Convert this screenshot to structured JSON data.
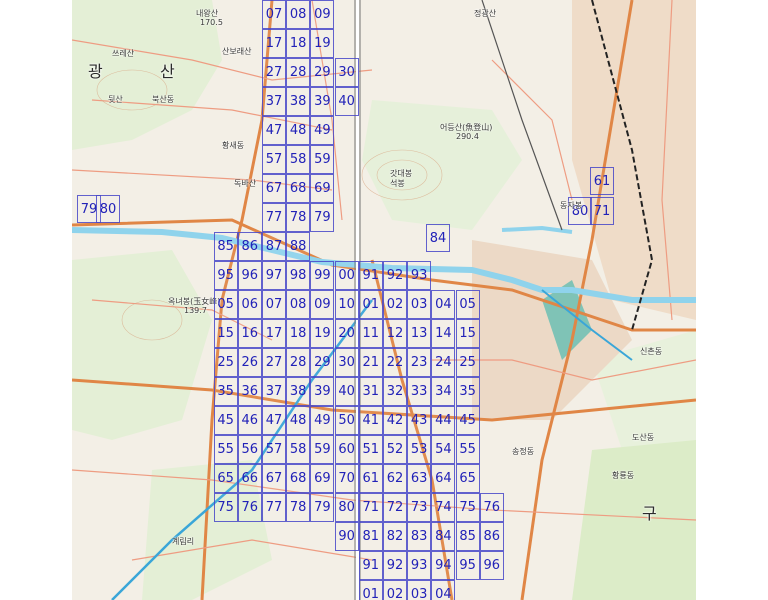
{
  "map": {
    "grid_cells": [
      {
        "label": "07",
        "col": 1,
        "row": 0
      },
      {
        "label": "08",
        "col": 2,
        "row": 0
      },
      {
        "label": "09",
        "col": 3,
        "row": 0
      },
      {
        "label": "17",
        "col": 1,
        "row": 1
      },
      {
        "label": "18",
        "col": 2,
        "row": 1
      },
      {
        "label": "19",
        "col": 3,
        "row": 1
      },
      {
        "label": "27",
        "col": 1,
        "row": 2
      },
      {
        "label": "28",
        "col": 2,
        "row": 2
      },
      {
        "label": "29",
        "col": 3,
        "row": 2
      },
      {
        "label": "30",
        "col": 4,
        "row": 2
      },
      {
        "label": "37",
        "col": 1,
        "row": 3
      },
      {
        "label": "38",
        "col": 2,
        "row": 3
      },
      {
        "label": "39",
        "col": 3,
        "row": 3
      },
      {
        "label": "40",
        "col": 4,
        "row": 3
      },
      {
        "label": "47",
        "col": 1,
        "row": 4
      },
      {
        "label": "48",
        "col": 2,
        "row": 4
      },
      {
        "label": "49",
        "col": 3,
        "row": 4
      },
      {
        "label": "57",
        "col": 1,
        "row": 5
      },
      {
        "label": "58",
        "col": 2,
        "row": 5
      },
      {
        "label": "59",
        "col": 3,
        "row": 5
      },
      {
        "label": "67",
        "col": 1,
        "row": 6
      },
      {
        "label": "68",
        "col": 2,
        "row": 6
      },
      {
        "label": "69",
        "col": 3,
        "row": 6
      },
      {
        "label": "77",
        "col": 1,
        "row": 7
      },
      {
        "label": "78",
        "col": 2,
        "row": 7
      },
      {
        "label": "79",
        "col": 3,
        "row": 7
      },
      {
        "label": "85",
        "col": -1,
        "row": 8
      },
      {
        "label": "86",
        "col": 0,
        "row": 8
      },
      {
        "label": "87",
        "col": 1,
        "row": 8
      },
      {
        "label": "88",
        "col": 2,
        "row": 8
      },
      {
        "label": "95",
        "col": -1,
        "row": 9
      },
      {
        "label": "96",
        "col": 0,
        "row": 9
      },
      {
        "label": "97",
        "col": 1,
        "row": 9
      },
      {
        "label": "98",
        "col": 2,
        "row": 9
      },
      {
        "label": "99",
        "col": 3,
        "row": 9
      },
      {
        "label": "00",
        "col": 4,
        "row": 9
      },
      {
        "label": "91",
        "col": 5,
        "row": 9
      },
      {
        "label": "92",
        "col": 6,
        "row": 9
      },
      {
        "label": "93",
        "col": 7,
        "row": 9
      },
      {
        "label": "05",
        "col": -1,
        "row": 10
      },
      {
        "label": "06",
        "col": 0,
        "row": 10
      },
      {
        "label": "07",
        "col": 1,
        "row": 10
      },
      {
        "label": "08",
        "col": 2,
        "row": 10
      },
      {
        "label": "09",
        "col": 3,
        "row": 10
      },
      {
        "label": "10",
        "col": 4,
        "row": 10
      },
      {
        "label": "01",
        "col": 5,
        "row": 10
      },
      {
        "label": "02",
        "col": 6,
        "row": 10
      },
      {
        "label": "03",
        "col": 7,
        "row": 10
      },
      {
        "label": "04",
        "col": 8,
        "row": 10
      },
      {
        "label": "05",
        "col": 9,
        "row": 10
      },
      {
        "label": "15",
        "col": -1,
        "row": 11
      },
      {
        "label": "16",
        "col": 0,
        "row": 11
      },
      {
        "label": "17",
        "col": 1,
        "row": 11
      },
      {
        "label": "18",
        "col": 2,
        "row": 11
      },
      {
        "label": "19",
        "col": 3,
        "row": 11
      },
      {
        "label": "20",
        "col": 4,
        "row": 11
      },
      {
        "label": "11",
        "col": 5,
        "row": 11
      },
      {
        "label": "12",
        "col": 6,
        "row": 11
      },
      {
        "label": "13",
        "col": 7,
        "row": 11
      },
      {
        "label": "14",
        "col": 8,
        "row": 11
      },
      {
        "label": "15",
        "col": 9,
        "row": 11
      },
      {
        "label": "25",
        "col": -1,
        "row": 12
      },
      {
        "label": "26",
        "col": 0,
        "row": 12
      },
      {
        "label": "27",
        "col": 1,
        "row": 12
      },
      {
        "label": "28",
        "col": 2,
        "row": 12
      },
      {
        "label": "29",
        "col": 3,
        "row": 12
      },
      {
        "label": "30",
        "col": 4,
        "row": 12
      },
      {
        "label": "21",
        "col": 5,
        "row": 12
      },
      {
        "label": "22",
        "col": 6,
        "row": 12
      },
      {
        "label": "23",
        "col": 7,
        "row": 12
      },
      {
        "label": "24",
        "col": 8,
        "row": 12
      },
      {
        "label": "25",
        "col": 9,
        "row": 12
      },
      {
        "label": "35",
        "col": -1,
        "row": 13
      },
      {
        "label": "36",
        "col": 0,
        "row": 13
      },
      {
        "label": "37",
        "col": 1,
        "row": 13
      },
      {
        "label": "38",
        "col": 2,
        "row": 13
      },
      {
        "label": "39",
        "col": 3,
        "row": 13
      },
      {
        "label": "40",
        "col": 4,
        "row": 13
      },
      {
        "label": "31",
        "col": 5,
        "row": 13
      },
      {
        "label": "32",
        "col": 6,
        "row": 13
      },
      {
        "label": "33",
        "col": 7,
        "row": 13
      },
      {
        "label": "34",
        "col": 8,
        "row": 13
      },
      {
        "label": "35",
        "col": 9,
        "row": 13
      },
      {
        "label": "45",
        "col": -1,
        "row": 14
      },
      {
        "label": "46",
        "col": 0,
        "row": 14
      },
      {
        "label": "47",
        "col": 1,
        "row": 14
      },
      {
        "label": "48",
        "col": 2,
        "row": 14
      },
      {
        "label": "49",
        "col": 3,
        "row": 14
      },
      {
        "label": "50",
        "col": 4,
        "row": 14
      },
      {
        "label": "41",
        "col": 5,
        "row": 14
      },
      {
        "label": "42",
        "col": 6,
        "row": 14
      },
      {
        "label": "43",
        "col": 7,
        "row": 14
      },
      {
        "label": "44",
        "col": 8,
        "row": 14
      },
      {
        "label": "45",
        "col": 9,
        "row": 14
      },
      {
        "label": "55",
        "col": -1,
        "row": 15
      },
      {
        "label": "56",
        "col": 0,
        "row": 15
      },
      {
        "label": "57",
        "col": 1,
        "row": 15
      },
      {
        "label": "58",
        "col": 2,
        "row": 15
      },
      {
        "label": "59",
        "col": 3,
        "row": 15
      },
      {
        "label": "60",
        "col": 4,
        "row": 15
      },
      {
        "label": "51",
        "col": 5,
        "row": 15
      },
      {
        "label": "52",
        "col": 6,
        "row": 15
      },
      {
        "label": "53",
        "col": 7,
        "row": 15
      },
      {
        "label": "54",
        "col": 8,
        "row": 15
      },
      {
        "label": "55",
        "col": 9,
        "row": 15
      },
      {
        "label": "65",
        "col": -1,
        "row": 16
      },
      {
        "label": "66",
        "col": 0,
        "row": 16
      },
      {
        "label": "67",
        "col": 1,
        "row": 16
      },
      {
        "label": "68",
        "col": 2,
        "row": 16
      },
      {
        "label": "69",
        "col": 3,
        "row": 16
      },
      {
        "label": "70",
        "col": 4,
        "row": 16
      },
      {
        "label": "61",
        "col": 5,
        "row": 16
      },
      {
        "label": "62",
        "col": 6,
        "row": 16
      },
      {
        "label": "63",
        "col": 7,
        "row": 16
      },
      {
        "label": "64",
        "col": 8,
        "row": 16
      },
      {
        "label": "65",
        "col": 9,
        "row": 16
      },
      {
        "label": "75",
        "col": -1,
        "row": 17
      },
      {
        "label": "76",
        "col": 0,
        "row": 17
      },
      {
        "label": "77",
        "col": 1,
        "row": 17
      },
      {
        "label": "78",
        "col": 2,
        "row": 17
      },
      {
        "label": "79",
        "col": 3,
        "row": 17
      },
      {
        "label": "80",
        "col": 4,
        "row": 17
      },
      {
        "label": "71",
        "col": 5,
        "row": 17
      },
      {
        "label": "72",
        "col": 6,
        "row": 17
      },
      {
        "label": "73",
        "col": 7,
        "row": 17
      },
      {
        "label": "74",
        "col": 8,
        "row": 17
      },
      {
        "label": "75",
        "col": 9,
        "row": 17
      },
      {
        "label": "76",
        "col": 10,
        "row": 17
      },
      {
        "label": "90",
        "col": 4,
        "row": 18
      },
      {
        "label": "81",
        "col": 5,
        "row": 18
      },
      {
        "label": "82",
        "col": 6,
        "row": 18
      },
      {
        "label": "83",
        "col": 7,
        "row": 18
      },
      {
        "label": "84",
        "col": 8,
        "row": 18
      },
      {
        "label": "85",
        "col": 9,
        "row": 18
      },
      {
        "label": "86",
        "col": 10,
        "row": 18
      },
      {
        "label": "91",
        "col": 5,
        "row": 19
      },
      {
        "label": "92",
        "col": 6,
        "row": 19
      },
      {
        "label": "93",
        "col": 7,
        "row": 19
      },
      {
        "label": "94",
        "col": 8,
        "row": 19
      },
      {
        "label": "95",
        "col": 9,
        "row": 19
      },
      {
        "label": "96",
        "col": 10,
        "row": 19
      },
      {
        "label": "01",
        "col": 5,
        "row": 20
      },
      {
        "label": "02",
        "col": 6,
        "row": 20
      },
      {
        "label": "03",
        "col": 7,
        "row": 20
      },
      {
        "label": "04",
        "col": 8,
        "row": 20
      }
    ],
    "isolated_cells": [
      {
        "label": "79",
        "id": "west-79"
      },
      {
        "label": "80",
        "id": "west-80"
      },
      {
        "label": "84",
        "id": "hill-84"
      },
      {
        "label": "61",
        "id": "east-61"
      },
      {
        "label": "80",
        "id": "east-80"
      },
      {
        "label": "71",
        "id": "east-71"
      }
    ],
    "place_labels": [
      {
        "text": "내왕산",
        "id": "naewangsan"
      },
      {
        "text": "170.5",
        "id": "elev-1705"
      },
      {
        "text": "산보래산",
        "id": "sanboraesan"
      },
      {
        "text": "쓰레산",
        "id": "sseuresan"
      },
      {
        "text": "광",
        "id": "gwang"
      },
      {
        "text": "산",
        "id": "san"
      },
      {
        "text": "뒷산",
        "id": "dwitsan"
      },
      {
        "text": "북산동",
        "id": "buksandong"
      },
      {
        "text": "황새동",
        "id": "hwangsaedong"
      },
      {
        "text": "독바산",
        "id": "dokbasan"
      },
      {
        "text": "옥녀봉(玉女峰)",
        "id": "oknyeobong"
      },
      {
        "text": "139.7",
        "id": "elev-1397"
      },
      {
        "text": "어등산(魚登山)",
        "id": "eodeungsan"
      },
      {
        "text": "290.4",
        "id": "elev-2904"
      },
      {
        "text": "갓대봉",
        "id": "gatdaebong"
      },
      {
        "text": "석봉",
        "id": "seokbong"
      },
      {
        "text": "동자봉",
        "id": "dongjabong"
      },
      {
        "text": "정광산",
        "id": "jeonggwangsan"
      },
      {
        "text": "구",
        "id": "gu"
      },
      {
        "text": "도산동",
        "id": "dosandong"
      },
      {
        "text": "송정동",
        "id": "songjeongdong"
      },
      {
        "text": "계림리",
        "id": "gyerimri"
      },
      {
        "text": "신촌동",
        "id": "sinchondong"
      },
      {
        "text": "황룡동",
        "id": "hwangryongdong"
      }
    ],
    "colors": {
      "grid_line": "#4646c8",
      "grid_text": "#2222b8",
      "water": "#8fd3ec",
      "river": "#3aa6d8",
      "arterial": "#e28a4a",
      "minor_road": "#ef9b80",
      "forest": "#cfe8b8"
    }
  }
}
